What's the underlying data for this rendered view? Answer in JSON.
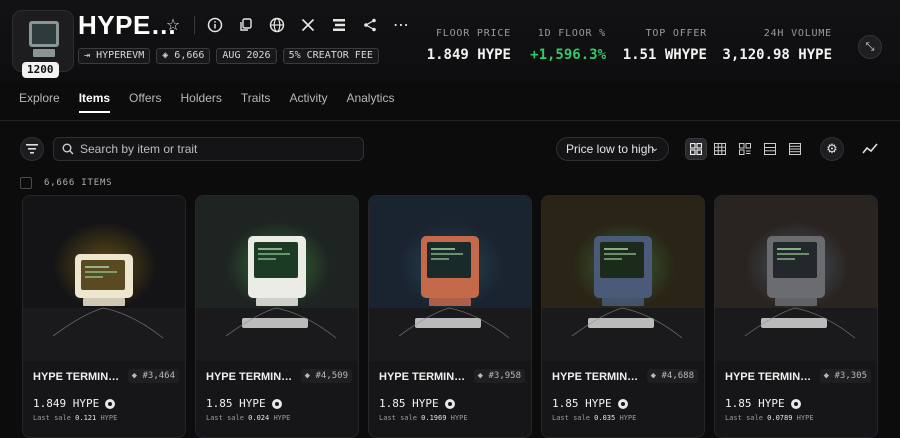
{
  "collection": {
    "title": "HYPE…",
    "avatar_badge": "1200",
    "chips": [
      "HYPEREVM",
      "6,666",
      "AUG 2026",
      "5% CREATOR FEE"
    ]
  },
  "stats": [
    {
      "label": "FLOOR PRICE",
      "value": "1.849 HYPE",
      "color": "#f2f2f2"
    },
    {
      "label": "1D FLOOR %",
      "value": "+1,596.3%",
      "color": "#34c768"
    },
    {
      "label": "TOP OFFER",
      "value": "1.51 WHYPE",
      "color": "#f2f2f2"
    },
    {
      "label": "24H VOLUME",
      "value": "3,120.98 HYPE",
      "color": "#f2f2f2"
    }
  ],
  "header_icons": [
    "star-icon",
    "info-icon",
    "copy-icon",
    "globe-icon",
    "x-icon",
    "list-icon",
    "share-icon",
    "more-icon"
  ],
  "tabs": [
    "Explore",
    "Items",
    "Offers",
    "Holders",
    "Traits",
    "Activity",
    "Analytics"
  ],
  "active_tab": "Items",
  "toolbar": {
    "search_placeholder": "Search by item or trait",
    "sort_label": "Price low to high",
    "items_count": "6,666 ITEMS"
  },
  "cards": [
    {
      "name": "HYPE TERMIN…",
      "number": "#3,464",
      "price": "1.849 HYPE",
      "last_sale_label": "Last sale",
      "last_sale_value": "0.121",
      "last_sale_unit": "HYPE",
      "bg": "#141416",
      "monitor": "#efe6cf",
      "screen": "#5a4a22",
      "glow": "#6a5418"
    },
    {
      "name": "HYPE TERMIN…",
      "number": "#4,509",
      "price": "1.85 HYPE",
      "last_sale_label": "Last sale",
      "last_sale_value": "0.024",
      "last_sale_unit": "HYPE",
      "bg": "#1e2422",
      "monitor": "#ecece6",
      "screen": "#1c3a24",
      "glow": "#3a7a3a"
    },
    {
      "name": "HYPE TERMIN…",
      "number": "#3,958",
      "price": "1.85 HYPE",
      "last_sale_label": "Last sale",
      "last_sale_value": "0.1969",
      "last_sale_unit": "HYPE",
      "bg": "#1a2430",
      "monitor": "#c46a4a",
      "screen": "#1a2a2a",
      "glow": "#2a4a5a"
    },
    {
      "name": "HYPE TERMIN…",
      "number": "#4,688",
      "price": "1.85 HYPE",
      "last_sale_label": "Last sale",
      "last_sale_value": "0.035",
      "last_sale_unit": "HYPE",
      "bg": "#2a2416",
      "monitor": "#4a5a78",
      "screen": "#1c2a1c",
      "glow": "#3a6a3a"
    },
    {
      "name": "HYPE TERMIN…",
      "number": "#3,305",
      "price": "1.85 HYPE",
      "last_sale_label": "Last sale",
      "last_sale_value": "0.0789",
      "last_sale_unit": "HYPE",
      "bg": "#2a2420",
      "monitor": "#6a6c70",
      "screen": "#22282c",
      "glow": "#4a5a6a"
    }
  ]
}
